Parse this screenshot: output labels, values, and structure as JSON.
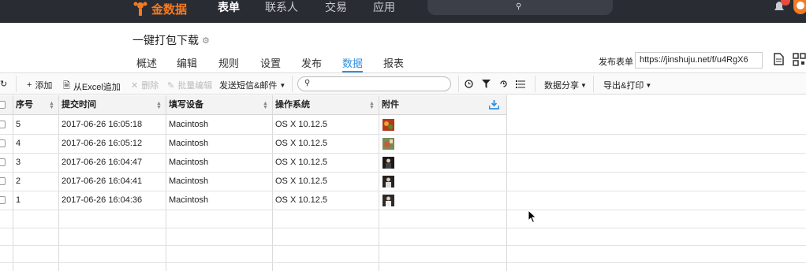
{
  "topnav": {
    "logo": "金数据",
    "items": [
      "表单",
      "联系人",
      "交易",
      "应用"
    ],
    "active": "表单",
    "notification_count": "3"
  },
  "form": {
    "title": "一键打包下载",
    "tabs": [
      "概述",
      "编辑",
      "规则",
      "设置",
      "发布",
      "数据",
      "报表"
    ],
    "active_tab": "数据",
    "publish_label": "发布表单",
    "publish_url": "https://jinshuju.net/f/u4RgX6"
  },
  "toolbar": {
    "add": "添加",
    "import_excel": "从Excel追加",
    "delete": "删除",
    "batch_edit": "批量编辑",
    "send_sms": "发送短信&邮件",
    "search_placeholder": "",
    "share": "数据分享",
    "export": "导出&打印"
  },
  "table": {
    "columns": [
      "序号",
      "提交时间",
      "填写设备",
      "操作系统",
      "附件"
    ],
    "rows": [
      {
        "id": "5",
        "time": "2017-06-26 16:05:18",
        "device": "Macintosh",
        "os": "OS X 10.12.5",
        "thumb": "food-a"
      },
      {
        "id": "4",
        "time": "2017-06-26 16:05:12",
        "device": "Macintosh",
        "os": "OS X 10.12.5",
        "thumb": "food-b"
      },
      {
        "id": "3",
        "time": "2017-06-26 16:04:47",
        "device": "Macintosh",
        "os": "OS X 10.12.5",
        "thumb": "portrait-a"
      },
      {
        "id": "2",
        "time": "2017-06-26 16:04:41",
        "device": "Macintosh",
        "os": "OS X 10.12.5",
        "thumb": "portrait-b"
      },
      {
        "id": "1",
        "time": "2017-06-26 16:04:36",
        "device": "Macintosh",
        "os": "OS X 10.12.5",
        "thumb": "portrait-c"
      }
    ]
  },
  "colors": {
    "topbar": "#2a2c34",
    "brand": "#f47b20",
    "accent": "#2f8fe0"
  }
}
